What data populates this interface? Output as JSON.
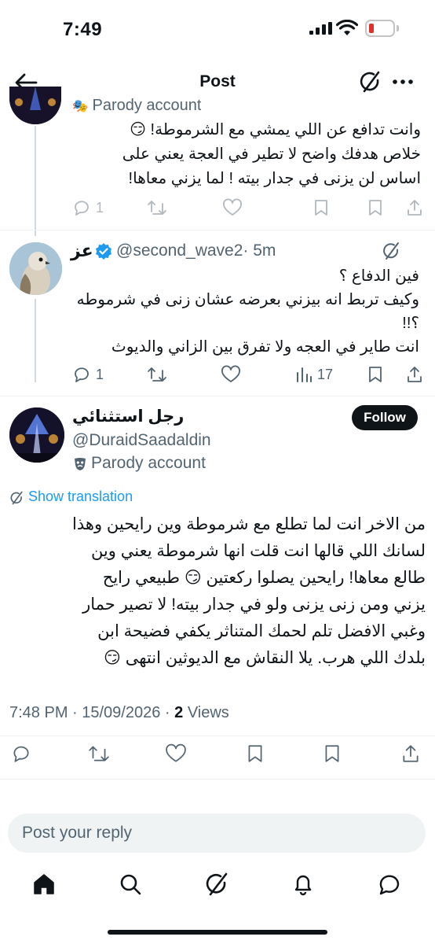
{
  "status_bar": {
    "time": "7:49"
  },
  "header": {
    "title": "Post"
  },
  "thread_parent": {
    "author_label": "Parody account",
    "text_lines": [
      "وانت تدافع عن اللي يمشي مع الشرموطة! 😏",
      "خلاص هدفك واضح لا تطير في العجة يعني على",
      "اساس لن يزنى في جدار بيته ! لما يزني معاها!"
    ],
    "actions": {
      "replies": "1"
    }
  },
  "reply_tweet": {
    "name": "عز",
    "handle": "@second_wave2",
    "time": "· 5m",
    "text_lines": [
      "فين الدفاع ؟",
      "وكيف تربط انه بيزني بعرضه عشان زنى في شرموطه",
      "؟!!",
      "انت طاير في العجه ولا تفرق بين الزاني والديوث"
    ],
    "actions": {
      "replies": "1",
      "views": "17"
    }
  },
  "main_tweet": {
    "name": "رجل استثنائي",
    "handle": "@DuraidSaadaldin",
    "badge_label": "Parody account",
    "follow_label": "Follow",
    "translate_label": "Show translation",
    "text_lines": [
      "من الاخر انت لما تطلع مع شرموطة وين رايحين وهذا",
      "لسانك اللي قالها انت قلت انها شرموطة يعني وين",
      "طالع معاها! رايحين يصلوا ركعتين 😏 طبيعي رايح",
      "يزني ومن زنى يزنى ولو في جدار بيته! لا تصير حمار",
      "وغبي الافضل تلم لحمك المتناثر يكفي فضيحة ابن",
      "بلدك اللي هرب. يلا النقاش مع الديوثين انتهى 😏"
    ],
    "timestamp": "7:48 PM · 15/09/2026 · ",
    "views_count": "2",
    "views_label": " Views"
  },
  "reply_input": {
    "placeholder": "Post your reply"
  },
  "colors": {
    "accent": "#1d9bf0",
    "text": "#0f1419",
    "secondary": "#536471",
    "divider": "#eff3f4",
    "verified": "#1d9bf0"
  },
  "icons": [
    "back-arrow-icon",
    "grok-icon",
    "more-icon",
    "reply-icon",
    "repost-icon",
    "like-icon",
    "views-icon",
    "bookmark-icon",
    "share-icon",
    "verified-badge-icon",
    "parody-mask-icon",
    "translate-icon",
    "home-icon",
    "search-icon",
    "notifications-icon",
    "messages-icon"
  ]
}
